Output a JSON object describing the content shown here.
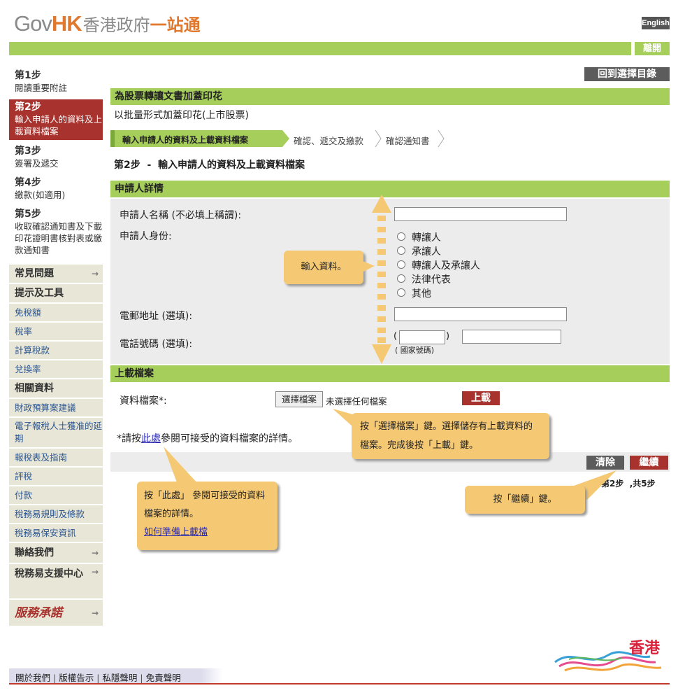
{
  "header": {
    "logo_gov": "Gov",
    "logo_hk": "HK",
    "logo_zh1": "香港政府",
    "logo_zh2": "一站通",
    "english_label": "English",
    "logout_label": "離開"
  },
  "steps": [
    {
      "title": "第1步",
      "desc": "閱讀重要附註"
    },
    {
      "title": "第2步",
      "desc": "輸入申請人的資料及上載資料檔案"
    },
    {
      "title": "第3步",
      "desc": "簽署及遞交"
    },
    {
      "title": "第4步",
      "desc": "繳款(如適用)"
    },
    {
      "title": "第5步",
      "desc": "收取確認通知書及下載印花證明書核對表或繳款通知書"
    }
  ],
  "sidebar_menu": [
    {
      "label": "常見問題",
      "type": "header",
      "arrow": true
    },
    {
      "label": "提示及工具",
      "type": "header",
      "arrow": false
    },
    {
      "label": "免稅額",
      "type": "link"
    },
    {
      "label": "稅率",
      "type": "link"
    },
    {
      "label": "計算稅款",
      "type": "link"
    },
    {
      "label": "兌換率",
      "type": "link"
    },
    {
      "label": "相關資料",
      "type": "header",
      "arrow": false
    },
    {
      "label": "財政預算案建議",
      "type": "link"
    },
    {
      "label": "電子報稅人士獲准的延期",
      "type": "link"
    },
    {
      "label": "報稅表及指南",
      "type": "link"
    },
    {
      "label": "評稅",
      "type": "link"
    },
    {
      "label": "付款",
      "type": "link"
    },
    {
      "label": "稅務易規則及條款",
      "type": "link"
    },
    {
      "label": "稅務易保安資訊",
      "type": "link"
    },
    {
      "label": "聯絡我們",
      "type": "header",
      "arrow": true
    },
    {
      "label": "稅務易支援中心",
      "type": "header",
      "arrow": true
    },
    {
      "label": "服務承諾",
      "type": "logo",
      "arrow": true
    }
  ],
  "main": {
    "back_button": "回到選擇目錄",
    "section_title": "為股票轉讓文書加蓋印花",
    "subtitle": "以批量形式加蓋印花(上市股票)",
    "breadcrumb": [
      "輸入申請人的資料及上載資料檔案",
      "確認、遞交及繳款",
      "確認通知書"
    ],
    "step_heading": "第2步  -  輸入申請人的資料及上載資料檔案",
    "applicant": {
      "title": "申請人詳情",
      "name_label": "申請人名稱  (不必填上稱謂):",
      "id_label": "申請人身份:",
      "roles": [
        "轉讓人",
        "承讓人",
        "轉讓人及承讓人",
        "法律代表",
        "其他"
      ],
      "email_label": "電郵地址  (選填):",
      "phone_label": "電話號碼  (選填):",
      "country_code_open": "(",
      "country_code_close": ")",
      "country_code_hint": "( 國家號碼)"
    },
    "upload": {
      "title": "上載檔案",
      "file_label": "資料檔案*:",
      "choose_button": "選擇檔案",
      "no_file_text": "未選擇任何檔案",
      "upload_button": "上載",
      "note_prefix": "*請按",
      "note_link": "此處",
      "note_suffix": "參閱可接受的資料檔案的詳情。"
    },
    "clear_button": "清除",
    "continue_button": "繼續",
    "step_counter": "第2步  ,共5步"
  },
  "callouts": {
    "input_data": "輸入資料。",
    "choose_file": "按「選擇檔案」鍵。選擇儲存有上載資料的檔案。完成後按「上載」鍵。",
    "here_details": "按「此處」 參閱可接受的資料檔案的詳情。",
    "here_link": "如何準備上載檔",
    "continue_hint": "按「繼續」鍵。"
  },
  "footer": {
    "links": [
      "關於我們",
      "版權告示",
      "私隱聲明",
      "免責聲明"
    ],
    "brand": "香港"
  },
  "colors": {
    "green": "#a6ce5a",
    "red": "#a8322d",
    "callout": "#f5c873",
    "grey_button": "#5c5c5c"
  }
}
